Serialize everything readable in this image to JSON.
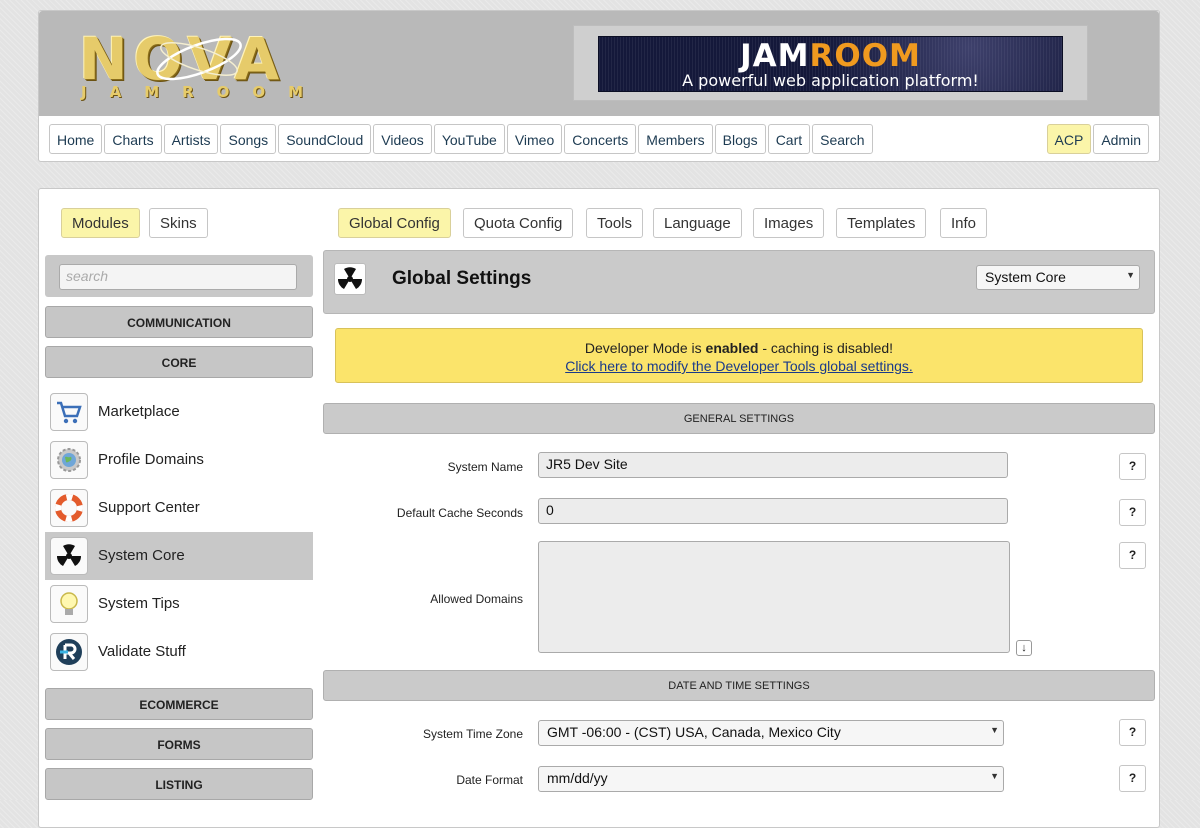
{
  "logo": {
    "main": "NOVA",
    "sub": "JAMROOM"
  },
  "ad": {
    "title_part1": "JAM",
    "title_part2": "ROOM",
    "tagline": "A powerful web application platform!"
  },
  "nav": {
    "items": [
      "Home",
      "Charts",
      "Artists",
      "Songs",
      "SoundCloud",
      "Videos",
      "YouTube",
      "Vimeo",
      "Concerts",
      "Members",
      "Blogs",
      "Cart",
      "Search"
    ],
    "acp": "ACP",
    "admin": "Admin"
  },
  "tabs": {
    "modules": "Modules",
    "skins": "Skins"
  },
  "config_tabs": [
    "Global Config",
    "Quota Config",
    "Tools",
    "Language",
    "Images",
    "Templates",
    "Info"
  ],
  "sidebar": {
    "search_placeholder": "search",
    "categories_top": [
      "COMMUNICATION",
      "CORE"
    ],
    "modules": [
      {
        "label": "Marketplace",
        "icon": "cart-icon"
      },
      {
        "label": "Profile Domains",
        "icon": "globe-gear-icon"
      },
      {
        "label": "Support Center",
        "icon": "lifebuoy-icon"
      },
      {
        "label": "System Core",
        "icon": "radiation-icon"
      },
      {
        "label": "System Tips",
        "icon": "lightbulb-icon"
      },
      {
        "label": "Validate Stuff",
        "icon": "validate-icon"
      }
    ],
    "categories_bottom": [
      "ECOMMERCE",
      "FORMS",
      "LISTING"
    ]
  },
  "panel": {
    "title": "Global Settings",
    "module_select": "System Core",
    "icon": "radiation-icon"
  },
  "notice": {
    "text_before": "Developer Mode is ",
    "text_bold": "enabled",
    "text_after": " - caching is disabled!",
    "link": "Click here to modify the Developer Tools global settings."
  },
  "sections": {
    "general": "GENERAL SETTINGS",
    "datetime": "DATE AND TIME SETTINGS"
  },
  "fields": {
    "system_name": {
      "label": "System Name",
      "value": "JR5 Dev Site"
    },
    "cache_seconds": {
      "label": "Default Cache Seconds",
      "value": "0"
    },
    "allowed_domains": {
      "label": "Allowed Domains",
      "value": ""
    },
    "time_zone": {
      "label": "System Time Zone",
      "value": "GMT -06:00 - (CST) USA, Canada, Mexico City"
    },
    "date_format": {
      "label": "Date Format",
      "value": "mm/dd/yy"
    }
  },
  "help_label": "?",
  "colors": {
    "highlight": "#fbf5a9",
    "notice": "#fbe46b",
    "link": "#1a3a8a",
    "header_bg": "#b9b9b9"
  }
}
